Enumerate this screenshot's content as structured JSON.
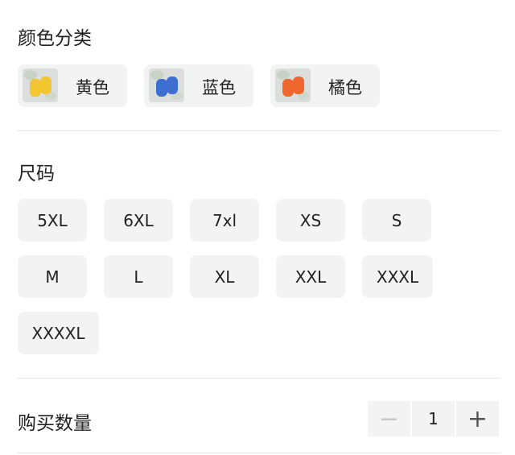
{
  "colors": {
    "title": "颜色分类",
    "options": [
      {
        "label": "黄色",
        "shoe_color": "#f2c62e"
      },
      {
        "label": "蓝色",
        "shoe_color": "#3d6fd0"
      },
      {
        "label": "橘色",
        "shoe_color": "#f0662f"
      }
    ]
  },
  "sizes": {
    "title": "尺码",
    "options": [
      "5XL",
      "6XL",
      "7xl",
      "XS",
      "S",
      "M",
      "L",
      "XL",
      "XXL",
      "XXXL",
      "XXXXL"
    ]
  },
  "quantity": {
    "title": "购买数量",
    "minus": "−",
    "value": "1",
    "plus": "+"
  }
}
